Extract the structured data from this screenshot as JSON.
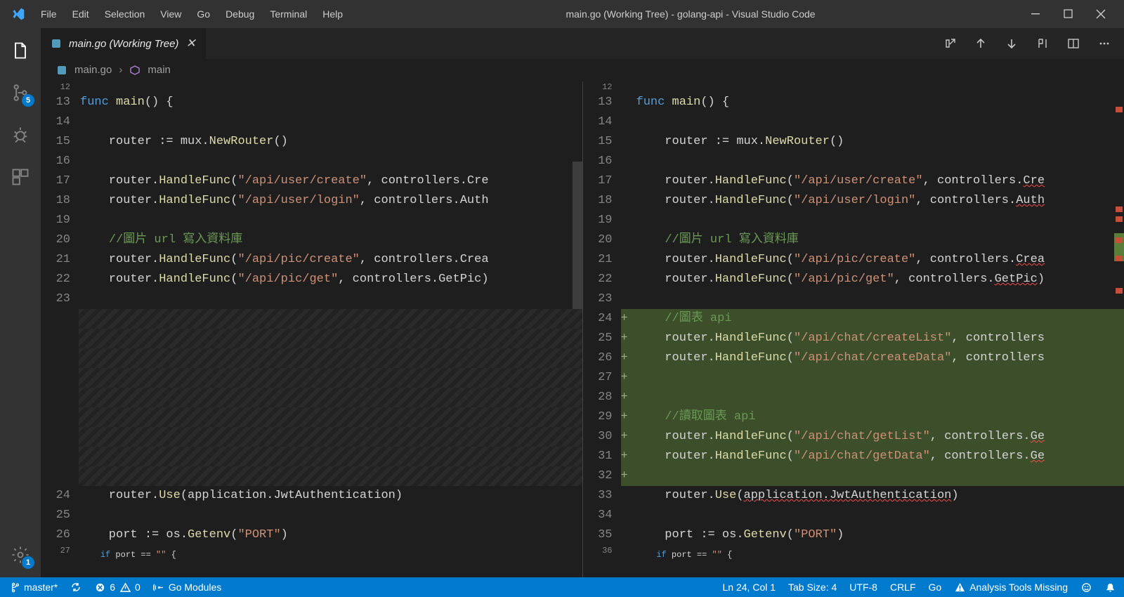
{
  "menubar": [
    "File",
    "Edit",
    "Selection",
    "View",
    "Go",
    "Debug",
    "Terminal",
    "Help"
  ],
  "window_title": "main.go (Working Tree) - golang-api - Visual Studio Code",
  "activity": {
    "scm_badge": "5",
    "settings_badge": "1"
  },
  "tab": {
    "label": "main.go (Working Tree)"
  },
  "breadcrumb": {
    "file": "main.go",
    "symbol": "main"
  },
  "left_pane": {
    "lines": [
      {
        "n": "12",
        "small": true,
        "html": ""
      },
      {
        "n": "13",
        "html": "<span class='kw'>func</span> <span class='fn'>main</span>() {"
      },
      {
        "n": "14",
        "html": ""
      },
      {
        "n": "15",
        "html": "    router := mux.<span class='fn'>NewRouter</span>()"
      },
      {
        "n": "16",
        "html": ""
      },
      {
        "n": "17",
        "html": "    router.<span class='fn'>HandleFunc</span>(<span class='str'>\"/api/user/create\"</span>, controllers.Cre"
      },
      {
        "n": "18",
        "html": "    router.<span class='fn'>HandleFunc</span>(<span class='str'>\"/api/user/login\"</span>, controllers.Auth"
      },
      {
        "n": "19",
        "html": ""
      },
      {
        "n": "20",
        "html": "    <span class='cmt'>//圖片 url 寫入資料庫</span>"
      },
      {
        "n": "21",
        "html": "    router.<span class='fn'>HandleFunc</span>(<span class='str'>\"/api/pic/create\"</span>, controllers.Crea"
      },
      {
        "n": "22",
        "html": "    router.<span class='fn'>HandleFunc</span>(<span class='str'>\"/api/pic/get\"</span>, controllers.GetPic)"
      },
      {
        "n": "23",
        "html": ""
      },
      {
        "n": "",
        "html": "",
        "cls": "hatched"
      },
      {
        "n": "",
        "html": "",
        "cls": "hatched"
      },
      {
        "n": "",
        "html": "",
        "cls": "hatched"
      },
      {
        "n": "",
        "html": "",
        "cls": "hatched"
      },
      {
        "n": "",
        "html": "",
        "cls": "hatched"
      },
      {
        "n": "",
        "html": "",
        "cls": "hatched"
      },
      {
        "n": "",
        "html": "",
        "cls": "hatched"
      },
      {
        "n": "",
        "html": "",
        "cls": "hatched"
      },
      {
        "n": "",
        "html": "",
        "cls": "hatched"
      },
      {
        "n": "24",
        "html": "    router.<span class='fn'>Use</span>(application.JwtAuthentication)"
      },
      {
        "n": "25",
        "html": ""
      },
      {
        "n": "26",
        "html": "    port := os.<span class='fn'>Getenv</span>(<span class='str'>\"PORT\"</span>)"
      },
      {
        "n": "27",
        "small": true,
        "html": "    <span class='kw'>if</span> port == <span class='str'>\"\"</span> {"
      }
    ]
  },
  "right_pane": {
    "lines": [
      {
        "n": "12",
        "small": true,
        "html": ""
      },
      {
        "n": "13",
        "html": "<span class='kw'>func</span> <span class='fn'>main</span>() {"
      },
      {
        "n": "14",
        "html": ""
      },
      {
        "n": "15",
        "html": "    router := mux.<span class='fn'>NewRouter</span>()"
      },
      {
        "n": "16",
        "html": ""
      },
      {
        "n": "17",
        "html": "    router.<span class='fn'>HandleFunc</span>(<span class='str'>\"/api/user/create\"</span>, controllers.<span class='err'>Cre</span>"
      },
      {
        "n": "18",
        "html": "    router.<span class='fn'>HandleFunc</span>(<span class='str'>\"/api/user/login\"</span>, controllers.<span class='err'>Auth</span>"
      },
      {
        "n": "19",
        "html": ""
      },
      {
        "n": "20",
        "html": "    <span class='cmt'>//圖片 url 寫入資料庫</span>"
      },
      {
        "n": "21",
        "html": "    router.<span class='fn'>HandleFunc</span>(<span class='str'>\"/api/pic/create\"</span>, controllers.<span class='err'>Crea</span>"
      },
      {
        "n": "22",
        "html": "    router.<span class='fn'>HandleFunc</span>(<span class='str'>\"/api/pic/get\"</span>, controllers.<span class='err'>GetPic</span>)"
      },
      {
        "n": "23",
        "html": ""
      },
      {
        "n": "24",
        "plus": "+",
        "cls": "added",
        "html": "    <span class='cmt'>//圖表 api</span>"
      },
      {
        "n": "25",
        "plus": "+",
        "cls": "added",
        "html": "    router.<span class='fn'>HandleFunc</span>(<span class='str'>\"/api/chat/createList\"</span>, controllers"
      },
      {
        "n": "26",
        "plus": "+",
        "cls": "added",
        "html": "    router.<span class='fn'>HandleFunc</span>(<span class='str'>\"/api/chat/createData\"</span>, controllers"
      },
      {
        "n": "27",
        "plus": "+",
        "cls": "added",
        "html": ""
      },
      {
        "n": "28",
        "plus": "+",
        "cls": "added",
        "html": ""
      },
      {
        "n": "29",
        "plus": "+",
        "cls": "added",
        "html": "    <span class='cmt'>//讀取圖表 api</span>"
      },
      {
        "n": "30",
        "plus": "+",
        "cls": "added",
        "html": "    router.<span class='fn'>HandleFunc</span>(<span class='str'>\"/api/chat/getList\"</span>, controllers.<span class='err'>Ge</span>"
      },
      {
        "n": "31",
        "plus": "+",
        "cls": "added",
        "html": "    router.<span class='fn'>HandleFunc</span>(<span class='str'>\"/api/chat/getData\"</span>, controllers.<span class='err'>Ge</span>"
      },
      {
        "n": "32",
        "plus": "+",
        "cls": "added",
        "html": ""
      },
      {
        "n": "33",
        "html": "    router.<span class='fn'>Use</span>(<span class='err'>application.JwtAuthentication</span>)"
      },
      {
        "n": "34",
        "html": ""
      },
      {
        "n": "35",
        "html": "    port := os.<span class='fn'>Getenv</span>(<span class='str'>\"PORT\"</span>)"
      },
      {
        "n": "36",
        "small": true,
        "html": "    <span class='kw'>if</span> port == <span class='str'>\"\"</span> {"
      }
    ]
  },
  "status": {
    "branch": "master*",
    "errors": "6",
    "warnings": "0",
    "go_modules": "Go Modules",
    "ln_col": "Ln 24, Col 1",
    "tab_size": "Tab Size: 4",
    "encoding": "UTF-8",
    "eol": "CRLF",
    "language": "Go",
    "analysis": "Analysis Tools Missing"
  }
}
